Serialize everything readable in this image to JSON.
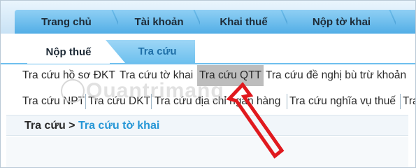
{
  "topnav": {
    "tabs": [
      {
        "label": "Trang chủ"
      },
      {
        "label": "Tài khoản"
      },
      {
        "label": "Khai thuế"
      },
      {
        "label": "Nộp tờ khai"
      }
    ]
  },
  "subnav": {
    "tabs": [
      {
        "label": "Nộp thuế"
      },
      {
        "label": "Tra cứu"
      }
    ]
  },
  "links_row1": [
    {
      "label": "Tra cứu hồ sơ ĐKT"
    },
    {
      "label": "Tra cứu tờ khai"
    },
    {
      "label": "Tra cứu QTT"
    },
    {
      "label": "Tra cứu đề nghị bù trừ khoản"
    }
  ],
  "links_row2": [
    {
      "label": "Tra cứu NPT"
    },
    {
      "label": "Tra cứu DKT"
    },
    {
      "label": "Tra cứu địa chỉ ngân hàng"
    },
    {
      "label": "Tra cứu nghĩa vụ thuế"
    },
    {
      "label": "Tra"
    }
  ],
  "breadcrumb": {
    "root": "Tra cứu >",
    "current": "Tra cứu tờ khai"
  },
  "watermark": {
    "text": "Quantrimang"
  },
  "colors": {
    "tab_blue": "#52aee6",
    "link_highlight": "#bdbdbd",
    "breadcrumb_current": "#2596d6",
    "annotation_arrow": "#e0191e"
  }
}
